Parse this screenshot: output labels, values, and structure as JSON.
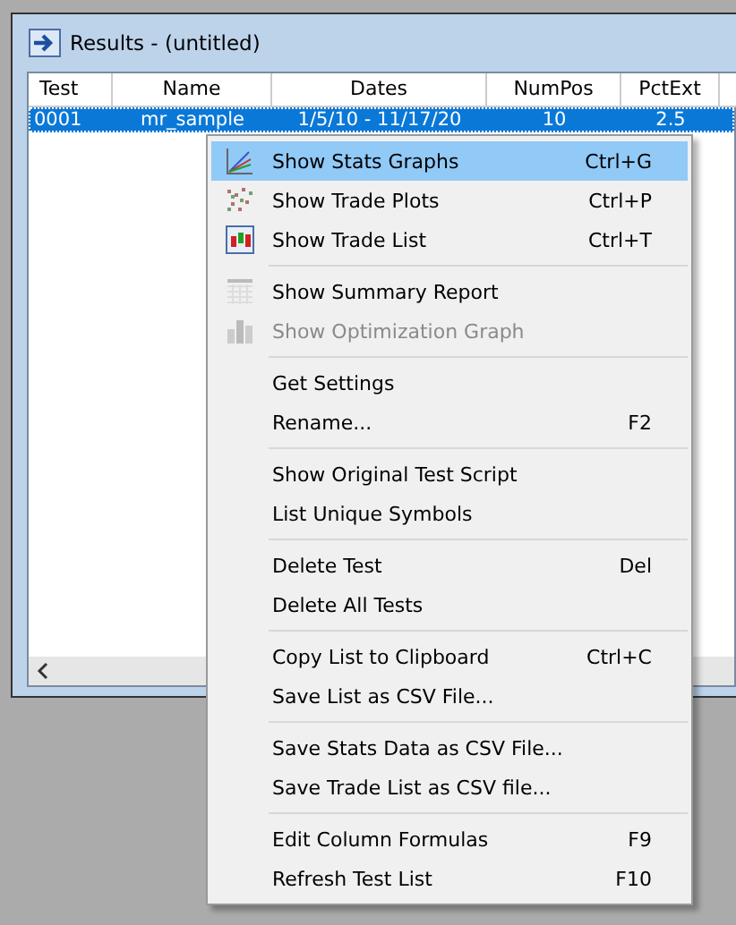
{
  "window": {
    "title": "Results - (untitled)"
  },
  "table": {
    "columns": [
      "Test",
      "Name",
      "Dates",
      "NumPos",
      "PctExt"
    ],
    "rows": [
      {
        "selected": true,
        "cells": [
          "0001",
          "mr_sample",
          "1/5/10 - 11/17/20",
          "10",
          "2.5"
        ]
      }
    ]
  },
  "context_menu": {
    "groups": [
      [
        {
          "label": "Show Stats Graphs",
          "shortcut": "Ctrl+G",
          "kind": "stats",
          "selected": true,
          "disabled": false
        },
        {
          "label": "Show Trade Plots",
          "shortcut": "Ctrl+P",
          "kind": "plots",
          "selected": false,
          "disabled": false
        },
        {
          "label": "Show Trade List",
          "shortcut": "Ctrl+T",
          "kind": "list",
          "selected": false,
          "disabled": false
        }
      ],
      [
        {
          "label": "Show Summary Report",
          "kind": "report",
          "selected": false,
          "disabled": false
        },
        {
          "label": "Show Optimization Graph",
          "kind": "opt",
          "selected": false,
          "disabled": true
        }
      ],
      [
        {
          "label": "Get Settings",
          "selected": false,
          "disabled": false
        },
        {
          "label": "Rename...",
          "shortcut": "F2",
          "selected": false,
          "disabled": false
        }
      ],
      [
        {
          "label": "Show Original Test Script",
          "selected": false,
          "disabled": false
        },
        {
          "label": "List Unique Symbols",
          "selected": false,
          "disabled": false
        }
      ],
      [
        {
          "label": "Delete Test",
          "shortcut": "Del",
          "selected": false,
          "disabled": false
        },
        {
          "label": "Delete All Tests",
          "selected": false,
          "disabled": false
        }
      ],
      [
        {
          "label": "Copy List to Clipboard",
          "shortcut": "Ctrl+C",
          "selected": false,
          "disabled": false
        },
        {
          "label": "Save List as CSV File...",
          "selected": false,
          "disabled": false
        }
      ],
      [
        {
          "label": "Save Stats Data as CSV File...",
          "selected": false,
          "disabled": false
        },
        {
          "label": "Save Trade List as CSV file...",
          "selected": false,
          "disabled": false
        }
      ],
      [
        {
          "label": "Edit Column Formulas",
          "shortcut": "F9",
          "selected": false,
          "disabled": false
        },
        {
          "label": "Refresh Test List",
          "shortcut": "F10",
          "selected": false,
          "disabled": false
        }
      ]
    ]
  }
}
